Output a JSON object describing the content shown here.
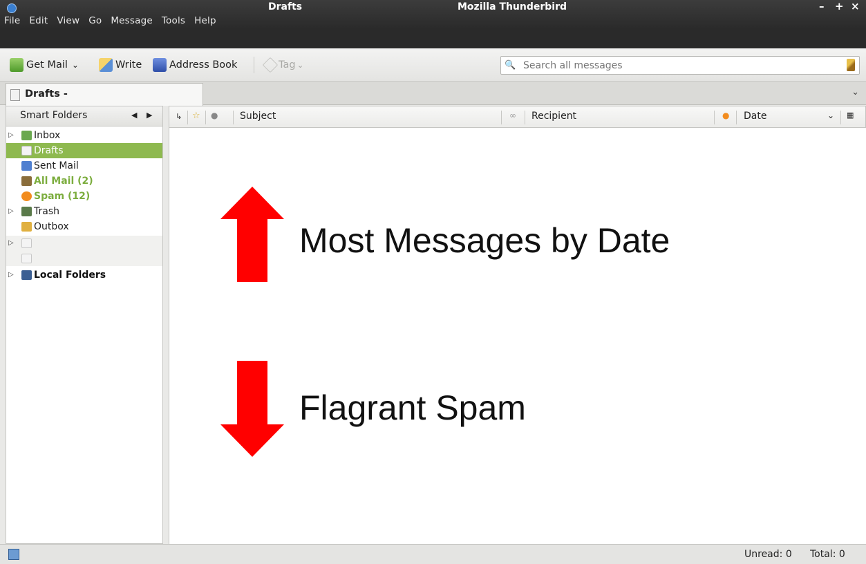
{
  "window": {
    "document_title": "Drafts",
    "app_title": "Mozilla Thunderbird",
    "controls": [
      "–",
      "+",
      "×"
    ]
  },
  "menu": {
    "items": [
      {
        "label": "File"
      },
      {
        "label": "Edit"
      },
      {
        "label": "View"
      },
      {
        "label": "Go"
      },
      {
        "label": "Message"
      },
      {
        "label": "Tools"
      },
      {
        "label": "Help"
      }
    ]
  },
  "toolbar": {
    "get_mail": "Get Mail",
    "get_mail_arrow": "⌄",
    "write": "Write",
    "address_book": "Address Book",
    "tag": "Tag",
    "tag_arrow": "⌄"
  },
  "search": {
    "placeholder": "Search all messages",
    "value": ""
  },
  "tabs": {
    "active_label": "Drafts -",
    "list_chevron": "⌄"
  },
  "folder_pane": {
    "header": "Smart Folders",
    "prev": "◀",
    "next": "▶",
    "folders": [
      {
        "label": "Inbox",
        "twisty": "▷",
        "icon": "inbox-icon",
        "color": "#6aa84f"
      },
      {
        "label": "Drafts",
        "twisty": "",
        "icon": "drafts-icon",
        "color": "#dcdcdc",
        "selected": true
      },
      {
        "label": "Sent Mail",
        "twisty": "",
        "icon": "sent-icon",
        "color": "#4f7fd0"
      },
      {
        "label": "All Mail (2)",
        "twisty": "",
        "icon": "archive-icon",
        "color": "#8a6d3b",
        "style": "green"
      },
      {
        "label": "Spam (12)",
        "twisty": "",
        "icon": "spam-icon",
        "color": "#f28c1e",
        "style": "green"
      },
      {
        "label": "Trash",
        "twisty": "▷",
        "icon": "trash-icon",
        "color": "#5a7a4a"
      },
      {
        "label": "Outbox",
        "twisty": "",
        "icon": "outbox-icon",
        "color": "#e0b040"
      },
      {
        "label": "",
        "twisty": "▷",
        "icon": "account-icon",
        "color": "#e4e4e4",
        "style": "grey"
      },
      {
        "label": "",
        "twisty": "",
        "icon": "account-icon",
        "color": "#e4e4e4",
        "style": "grey"
      },
      {
        "label": "Local Folders",
        "twisty": "▷",
        "icon": "local-folders-icon",
        "color": "#3b5f93",
        "style": "bold"
      }
    ]
  },
  "thread_columns": {
    "subject": "Subject",
    "recipient": "Recipient",
    "date": "Date",
    "date_sort": "⌄"
  },
  "annotations": {
    "top": "Most Messages by Date",
    "bottom": "Flagrant Spam",
    "arrow_color": "#ff0000"
  },
  "status": {
    "unread": "Unread: 0",
    "total": "Total: 0"
  }
}
